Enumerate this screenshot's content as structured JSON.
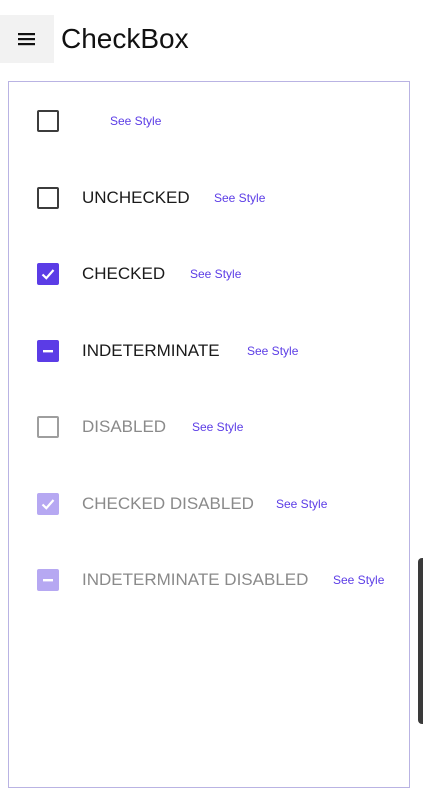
{
  "header": {
    "title": "CheckBox",
    "menu_icon": "hamburger-menu-icon"
  },
  "rows": [
    {
      "label": "",
      "state": "unchecked",
      "disabled": false,
      "link": "See Style"
    },
    {
      "label": "UNCHECKED",
      "state": "unchecked",
      "disabled": false,
      "link": "See Style"
    },
    {
      "label": "CHECKED",
      "state": "checked",
      "disabled": false,
      "link": "See Style"
    },
    {
      "label": "INDETERMINATE",
      "state": "indeterminate",
      "disabled": false,
      "link": "See Style"
    },
    {
      "label": "DISABLED",
      "state": "unchecked",
      "disabled": true,
      "link": "See Style"
    },
    {
      "label": "CHECKED DISABLED",
      "state": "checked",
      "disabled": true,
      "link": "See Style"
    },
    {
      "label": "INDETERMINATE DISABLED",
      "state": "indeterminate",
      "disabled": true,
      "link": "See Style"
    }
  ],
  "colors": {
    "accent": "#5b3ce6",
    "accent_disabled": "#b6a8f2",
    "panel_border": "#b9b3e3"
  }
}
